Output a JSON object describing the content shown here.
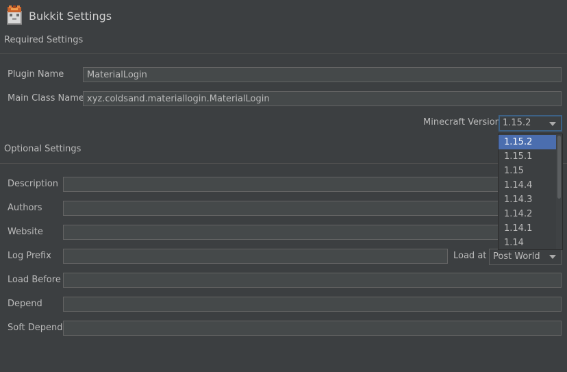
{
  "header": {
    "title": "Bukkit Settings",
    "icon": "bukkit-logo-icon"
  },
  "required": {
    "section_title": "Required Settings",
    "plugin_name_label": "Plugin Name",
    "plugin_name_value": "MaterialLogin",
    "main_class_label": "Main Class Name",
    "main_class_value": "xyz.coldsand.materiallogin.MaterialLogin",
    "mc_version_label": "Minecraft Version",
    "mc_version_value": "1.15.2"
  },
  "version_dropdown": {
    "options": [
      "1.15.2",
      "1.15.1",
      "1.15",
      "1.14.4",
      "1.14.3",
      "1.14.2",
      "1.14.1",
      "1.14"
    ],
    "selected": "1.15.2"
  },
  "optional": {
    "section_title": "Optional Settings",
    "description_label": "Description",
    "description_value": "",
    "authors_label": "Authors",
    "authors_value": "",
    "website_label": "Website",
    "website_value": "",
    "log_prefix_label": "Log Prefix",
    "log_prefix_value": "",
    "load_at_label": "Load at",
    "load_at_value": "Post World",
    "load_before_label": "Load Before",
    "load_before_value": "",
    "depend_label": "Depend",
    "depend_value": "",
    "soft_depend_label": "Soft Depend",
    "soft_depend_value": ""
  },
  "colors": {
    "background": "#3c3f41",
    "field_bg": "#45494a",
    "selection": "#4b6eaf",
    "focus_border": "#3d6185"
  }
}
